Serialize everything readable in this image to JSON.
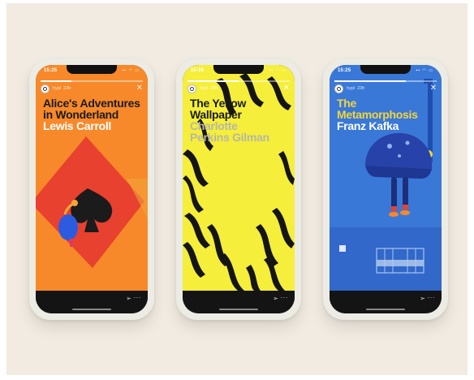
{
  "phones": [
    {
      "time": "15:25",
      "username": "hypl",
      "age": "23h",
      "title_line1": "Alice's Adventures",
      "title_line2": "in Wonderland",
      "author": "Lewis Carroll",
      "progress": 0.3,
      "colors": {
        "background": "#f7892a",
        "accent": "#e8412f",
        "title": "#1b1b1b",
        "author": "#ffffff"
      }
    },
    {
      "time": "15:25",
      "username": "hypl",
      "age": "23h",
      "title_line1": "The Yellow",
      "title_line2": "Wallpaper",
      "author_line1": "Charlotte",
      "author_line2": "Perkins Gilman",
      "progress": 0.5,
      "colors": {
        "background": "#f5ee3a",
        "accent": "#151515",
        "title": "#1b1b1b",
        "author": "#b7b7a8"
      }
    },
    {
      "time": "15:25",
      "username": "hypl",
      "age": "23h",
      "title_line1": "The",
      "title_line2": "Metamorphosis",
      "author": "Franz Kafka",
      "progress": 0.7,
      "colors": {
        "background": "#3a78d8",
        "accent": "#2742a8",
        "title": "#f3d53a",
        "author": "#ffffff"
      }
    }
  ],
  "icons": {
    "close": "close-icon",
    "send": "send-icon",
    "more": "more-icon",
    "avatar": "avatar-icon"
  }
}
